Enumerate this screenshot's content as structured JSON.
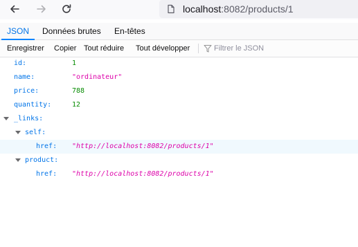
{
  "browser": {
    "url_host": "localhost",
    "url_rest": ":8082/products/1"
  },
  "viewer": {
    "tabs": [
      {
        "label": "JSON",
        "active": true
      },
      {
        "label": "Données brutes",
        "active": false
      },
      {
        "label": "En-têtes",
        "active": false
      }
    ],
    "toolbar": {
      "save": "Enregistrer",
      "copy": "Copier",
      "collapse_all": "Tout réduire",
      "expand_all": "Tout développer",
      "filter_placeholder": "Filtrer le JSON"
    }
  },
  "json": {
    "id": {
      "key": "id:",
      "value": "1"
    },
    "name": {
      "key": "name:",
      "value": "\"ordinateur\""
    },
    "price": {
      "key": "price:",
      "value": "788"
    },
    "quantity": {
      "key": "quantity:",
      "value": "12"
    },
    "links": {
      "key": "_links:"
    },
    "self": {
      "key": "self:"
    },
    "self_href": {
      "key": "href:",
      "value": "\"http://localhost:8082/products/1\""
    },
    "product": {
      "key": "product:"
    },
    "product_href": {
      "key": "href:",
      "value": "\"http://localhost:8082/products/1\""
    }
  },
  "icons": {
    "back": "arrow-left-icon",
    "forward": "arrow-right-icon",
    "reload": "reload-icon",
    "page": "page-icon",
    "filter": "filter-icon",
    "twisty": "chevron-down-icon"
  },
  "colors": {
    "key": "#0074e8",
    "number": "#058b00",
    "string": "#dd00a9",
    "active_tab": "#0a84ff",
    "row_highlight": "#f0f9fe"
  }
}
